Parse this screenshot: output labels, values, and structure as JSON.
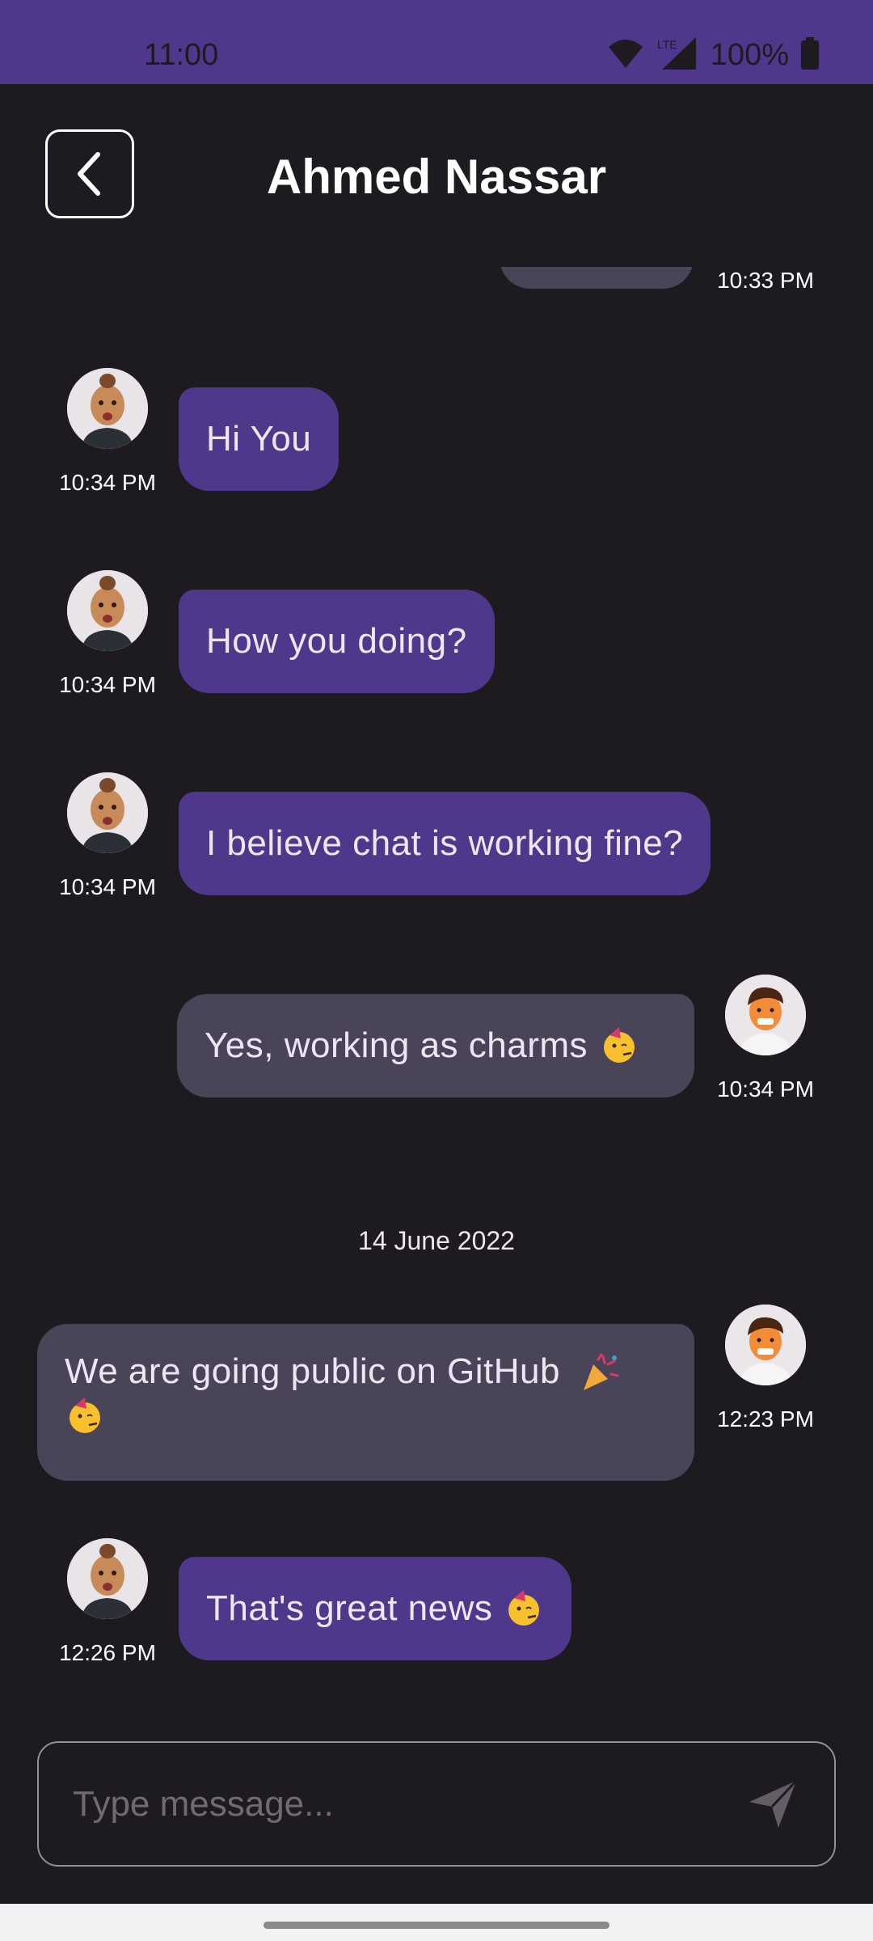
{
  "status_bar": {
    "time": "11:00",
    "network_label": "LTE",
    "battery": "100%",
    "icons": [
      "wifi-icon",
      "signal-icon",
      "battery-icon"
    ]
  },
  "header": {
    "title": "Ahmed Nassar",
    "back_icon": "chevron-left-icon"
  },
  "messages": [
    {
      "direction": "out",
      "text": "",
      "time": "10:33 PM"
    },
    {
      "direction": "in",
      "text": "Hi You",
      "time": "10:34 PM"
    },
    {
      "direction": "in",
      "text": "How you doing?",
      "time": "10:34 PM"
    },
    {
      "direction": "in",
      "text": "I believe chat is working fine?",
      "time": "10:34 PM"
    },
    {
      "direction": "out",
      "text": "Yes, working as charms",
      "emoji": "partying-face",
      "time": "10:34 PM"
    },
    {
      "direction": "out",
      "text": "We are going public on GitHub",
      "emoji": "party-popper, partying-face",
      "time": "12:23 PM"
    },
    {
      "direction": "in",
      "text": "That's great news",
      "emoji": "partying-face",
      "time": "12:26 PM"
    }
  ],
  "date_separator": "14 June 2022",
  "composer": {
    "placeholder": "Type message...",
    "value": "",
    "send_icon": "send-icon"
  },
  "colors": {
    "background": "#1d1b20",
    "incoming_bubble": "#4f378b",
    "outgoing_bubble": "#4a4458",
    "status_bar": "#4f378b"
  }
}
